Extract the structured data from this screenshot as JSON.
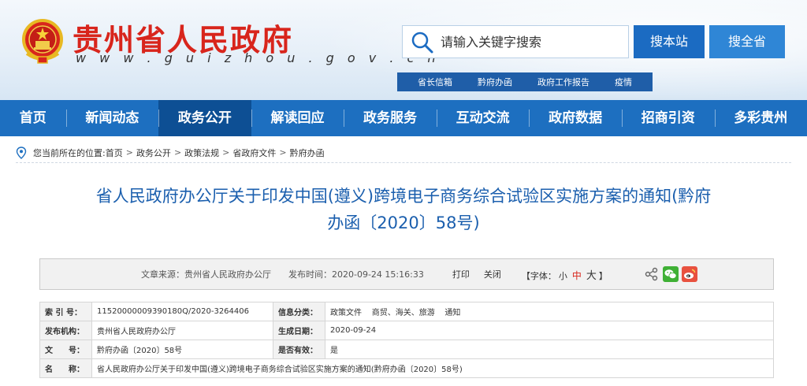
{
  "header": {
    "site_title": "贵州省人民政府",
    "site_url": "w w w . g u i z h o u . g o v . c n",
    "search_placeholder": "请输入关键字搜索",
    "search_site_label": "搜本站",
    "search_all_label": "搜全省",
    "quick_links": [
      "省长信箱",
      "黔府办函",
      "政府工作报告",
      "疫情"
    ]
  },
  "nav": {
    "items": [
      "首页",
      "新闻动态",
      "政务公开",
      "解读回应",
      "政务服务",
      "互动交流",
      "政府数据",
      "招商引资",
      "多彩贵州"
    ],
    "active_index": 2
  },
  "breadcrumb": {
    "prefix": "您当前所在的位置:",
    "items": [
      "首页",
      "政务公开",
      "政策法规",
      "省政府文件",
      "黔府办函"
    ]
  },
  "article": {
    "title_line1": "省人民政府办公厅关于印发中国(遵义)跨境电子商务综合试验区实施方案的通知(黔府",
    "title_line2": "办函〔2020〕58号)"
  },
  "info_bar": {
    "source": "文章来源：贵州省人民政府办公厅",
    "publish_time": "发布时间：2020-09-24 15:16:33",
    "print_label": "打印",
    "close_label": "关闭",
    "font_prefix": "【字体：",
    "font_small": "小",
    "font_medium": "中",
    "font_large": "大",
    "font_suffix": "】",
    "share_icons": [
      "share-icon",
      "wechat-icon",
      "weibo-icon"
    ]
  },
  "meta": {
    "index_label": "索 引 号：",
    "index_value": "11520000009390180Q/2020-3264406",
    "category_label": "信息分类：",
    "category_value": "政策文件    商贸、海关、旅游    通知",
    "issuer_label": "发布机构：",
    "issuer_value": "贵州省人民政府办公厅",
    "date_label": "生成日期：",
    "date_value": "2020-09-24",
    "docno_label": "文　　号：",
    "docno_value": "黔府办函〔2020〕58号",
    "valid_label": "是否有效：",
    "valid_value": "是",
    "name_label": "名　　称：",
    "name_value": "省人民政府办公厅关于印发中国(遵义)跨境电子商务综合试验区实施方案的通知(黔府办函〔2020〕58号)"
  },
  "colors": {
    "brand_red": "#d8251c",
    "nav_blue": "#1d6fc0",
    "nav_active": "#0d4f94",
    "title_blue": "#1b5fae"
  }
}
